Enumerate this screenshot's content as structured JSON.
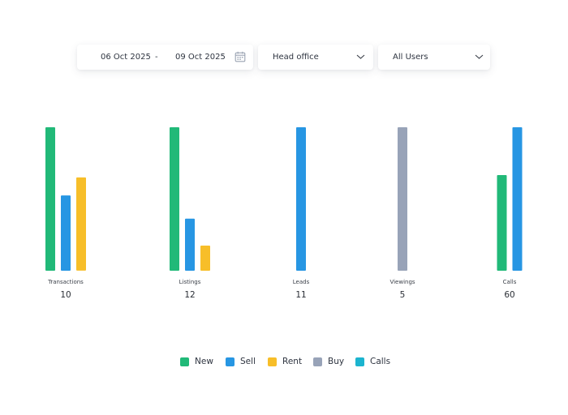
{
  "filters": {
    "date_from": "06 Oct 2025",
    "date_separator": "-",
    "date_to": "09 Oct 2025",
    "office": "Head office",
    "users": "All Users"
  },
  "colors": {
    "New": "#21b978",
    "Sell": "#2796e3",
    "Rent": "#f7be29",
    "Buy": "#98a3b8",
    "Calls": "#1cb4cf"
  },
  "legend": [
    {
      "label": "New",
      "color": "#21b978"
    },
    {
      "label": "Sell",
      "color": "#2796e3"
    },
    {
      "label": "Rent",
      "color": "#f7be29"
    },
    {
      "label": "Buy",
      "color": "#98a3b8"
    },
    {
      "label": "Calls",
      "color": "#1cb4cf"
    }
  ],
  "chart_data": {
    "type": "bar",
    "categories": [
      "Transactions",
      "Listings",
      "Leads",
      "Viewings",
      "Calls"
    ],
    "totals": [
      10,
      12,
      11,
      5,
      60
    ],
    "groups": [
      {
        "category": "Transactions",
        "bars": [
          {
            "series": "New",
            "value": 4
          },
          {
            "series": "Sell",
            "value": 2.1
          },
          {
            "series": "Rent",
            "value": 2.6
          }
        ]
      },
      {
        "category": "Listings",
        "bars": [
          {
            "series": "New",
            "value": 8
          },
          {
            "series": "Sell",
            "value": 2.9
          },
          {
            "series": "Rent",
            "value": 1.4
          }
        ]
      },
      {
        "category": "Leads",
        "bars": [
          {
            "series": "Sell",
            "value": 11
          }
        ]
      },
      {
        "category": "Viewings",
        "bars": [
          {
            "series": "Buy",
            "value": 5
          }
        ]
      },
      {
        "category": "Calls",
        "bars": [
          {
            "series": "New",
            "value": 40
          },
          {
            "series": "Sell",
            "value": 60
          }
        ]
      }
    ],
    "ylim": [
      0,
      null
    ],
    "grid": false,
    "legend_position": "bottom-center"
  }
}
